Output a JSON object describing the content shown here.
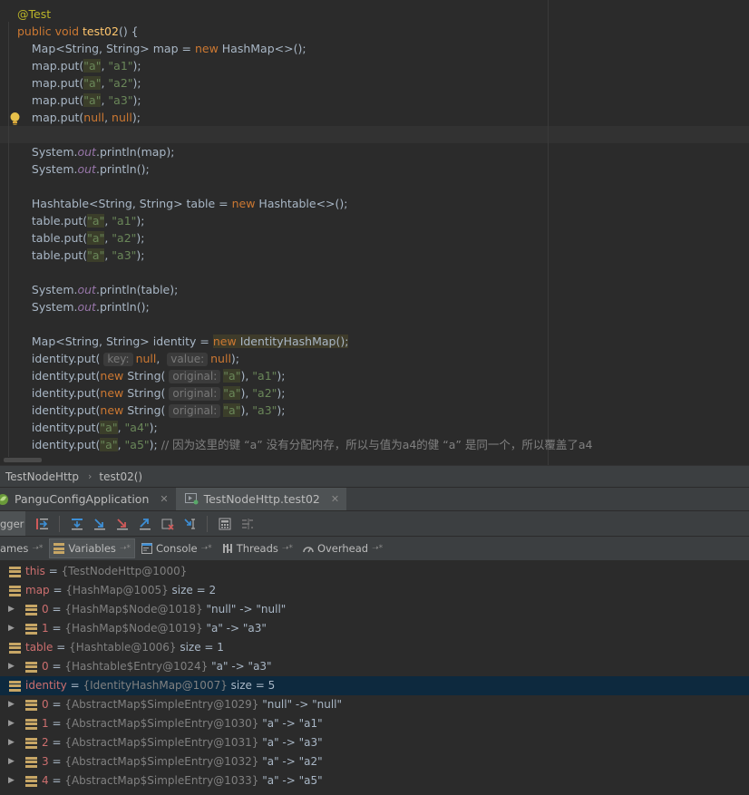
{
  "editor": {
    "lines": [
      {
        "segs": [
          {
            "t": "@Test",
            "c": "ann"
          }
        ]
      },
      {
        "segs": [
          {
            "t": "public ",
            "c": "kw"
          },
          {
            "t": "void ",
            "c": "kw"
          },
          {
            "t": "test02",
            "c": "fn"
          },
          {
            "t": "() {"
          }
        ]
      },
      {
        "segs": [
          {
            "t": "    Map<String, String> map = "
          },
          {
            "t": "new ",
            "c": "kw"
          },
          {
            "t": "HashMap<>();"
          }
        ]
      },
      {
        "segs": [
          {
            "t": "    map.put("
          },
          {
            "t": "\"a\"",
            "c": "str hl-str"
          },
          {
            "t": ", "
          },
          {
            "t": "\"a1\"",
            "c": "str"
          },
          {
            "t": ");"
          }
        ]
      },
      {
        "segs": [
          {
            "t": "    map.put("
          },
          {
            "t": "\"a\"",
            "c": "str hl-str"
          },
          {
            "t": ", "
          },
          {
            "t": "\"a2\"",
            "c": "str"
          },
          {
            "t": ");"
          }
        ]
      },
      {
        "segs": [
          {
            "t": "    map.put("
          },
          {
            "t": "\"a\"",
            "c": "str hl-str"
          },
          {
            "t": ", "
          },
          {
            "t": "\"a3\"",
            "c": "str"
          },
          {
            "t": ");"
          }
        ]
      },
      {
        "segs": [
          {
            "t": "    map.put("
          },
          {
            "t": "null",
            "c": "kw"
          },
          {
            "t": ", "
          },
          {
            "t": "null",
            "c": "kw"
          },
          {
            "t": ");"
          }
        ]
      },
      {
        "segs": []
      },
      {
        "segs": [
          {
            "t": "    System."
          },
          {
            "t": "out",
            "c": "fld"
          },
          {
            "t": ".println(map);"
          }
        ]
      },
      {
        "segs": [
          {
            "t": "    System."
          },
          {
            "t": "out",
            "c": "fld"
          },
          {
            "t": ".println();"
          }
        ]
      },
      {
        "segs": []
      },
      {
        "segs": [
          {
            "t": "    Hashtable<String, String> table = "
          },
          {
            "t": "new ",
            "c": "kw"
          },
          {
            "t": "Hashtable<>();"
          }
        ]
      },
      {
        "segs": [
          {
            "t": "    table.put("
          },
          {
            "t": "\"a\"",
            "c": "str hl-str"
          },
          {
            "t": ", "
          },
          {
            "t": "\"a1\"",
            "c": "str"
          },
          {
            "t": ");"
          }
        ]
      },
      {
        "segs": [
          {
            "t": "    table.put("
          },
          {
            "t": "\"a\"",
            "c": "str hl-str"
          },
          {
            "t": ", "
          },
          {
            "t": "\"a2\"",
            "c": "str"
          },
          {
            "t": ");"
          }
        ]
      },
      {
        "segs": [
          {
            "t": "    table.put("
          },
          {
            "t": "\"a\"",
            "c": "str hl-str"
          },
          {
            "t": ", "
          },
          {
            "t": "\"a3\"",
            "c": "str"
          },
          {
            "t": ");"
          }
        ]
      },
      {
        "segs": []
      },
      {
        "segs": [
          {
            "t": "    System."
          },
          {
            "t": "out",
            "c": "fld"
          },
          {
            "t": ".println(table);"
          }
        ]
      },
      {
        "segs": [
          {
            "t": "    System."
          },
          {
            "t": "out",
            "c": "fld"
          },
          {
            "t": ".println();"
          }
        ]
      },
      {
        "segs": []
      },
      {
        "segs": [
          {
            "t": "    Map<String, String> identity = "
          },
          {
            "t": "new ",
            "c": "kw hl-expr"
          },
          {
            "t": "IdentityHashMap();",
            "c": "hl-expr"
          }
        ]
      },
      {
        "segs": [
          {
            "t": "    identity.put( "
          },
          {
            "t": "key:",
            "c": "hint"
          },
          {
            "t": "null",
            "c": "kw"
          },
          {
            "t": ",  "
          },
          {
            "t": "value:",
            "c": "hint"
          },
          {
            "t": "null",
            "c": "kw"
          },
          {
            "t": ");"
          }
        ]
      },
      {
        "segs": [
          {
            "t": "    identity.put("
          },
          {
            "t": "new ",
            "c": "kw"
          },
          {
            "t": "String( "
          },
          {
            "t": "original:",
            "c": "hint"
          },
          {
            "t": "\"a\"",
            "c": "str hl-str"
          },
          {
            "t": "), "
          },
          {
            "t": "\"a1\"",
            "c": "str"
          },
          {
            "t": ");"
          }
        ]
      },
      {
        "segs": [
          {
            "t": "    identity.put("
          },
          {
            "t": "new ",
            "c": "kw"
          },
          {
            "t": "String( "
          },
          {
            "t": "original:",
            "c": "hint"
          },
          {
            "t": "\"a\"",
            "c": "str hl-str"
          },
          {
            "t": "), "
          },
          {
            "t": "\"a2\"",
            "c": "str"
          },
          {
            "t": ");"
          }
        ]
      },
      {
        "segs": [
          {
            "t": "    identity.put("
          },
          {
            "t": "new ",
            "c": "kw"
          },
          {
            "t": "String( "
          },
          {
            "t": "original:",
            "c": "hint"
          },
          {
            "t": "\"a\"",
            "c": "str hl-str"
          },
          {
            "t": "), "
          },
          {
            "t": "\"a3\"",
            "c": "str"
          },
          {
            "t": ");"
          }
        ]
      },
      {
        "segs": [
          {
            "t": "    identity.put("
          },
          {
            "t": "\"a\"",
            "c": "str hl-str"
          },
          {
            "t": ", "
          },
          {
            "t": "\"a4\"",
            "c": "str"
          },
          {
            "t": ");"
          }
        ]
      },
      {
        "segs": [
          {
            "t": "    identity.put("
          },
          {
            "t": "\"a\"",
            "c": "str hl-str"
          },
          {
            "t": ", "
          },
          {
            "t": "\"a5\"",
            "c": "str"
          },
          {
            "t": "); "
          },
          {
            "t": "// 因为这里的键 “a” 没有分配内存，所以与值为a4的健 “a” 是同一个，所以覆盖了a4",
            "c": "cmt"
          }
        ]
      }
    ]
  },
  "breadcrumb": {
    "items": [
      "TestNodeHttp",
      "test02()"
    ]
  },
  "run_tabs": [
    {
      "label": "PanguConfigApplication",
      "icon": "spring-boot-icon"
    },
    {
      "label": "TestNodeHttp.test02",
      "icon": "junit-run-icon"
    }
  ],
  "debugger": {
    "label": "gger"
  },
  "debug_tabs": [
    {
      "label": "ames",
      "icon": "frames-icon"
    },
    {
      "label": "Variables",
      "icon": "variables-icon"
    },
    {
      "label": "Console",
      "icon": "console-icon"
    },
    {
      "label": "Threads",
      "icon": "threads-icon"
    },
    {
      "label": "Overhead",
      "icon": "overhead-icon"
    }
  ],
  "variables": [
    {
      "level": 0,
      "expand": false,
      "name": "this",
      "type": "{TestNodeHttp@1000}",
      "value": ""
    },
    {
      "level": 0,
      "expand": false,
      "name": "map",
      "type": "{HashMap@1005}",
      "value": " size = 2"
    },
    {
      "level": 1,
      "expand": true,
      "name": "0",
      "type": "{HashMap$Node@1018}",
      "value": " \"null\" -> \"null\""
    },
    {
      "level": 1,
      "expand": true,
      "name": "1",
      "type": "{HashMap$Node@1019}",
      "value": " \"a\" -> \"a3\""
    },
    {
      "level": 0,
      "expand": false,
      "name": "table",
      "type": "{Hashtable@1006}",
      "value": " size = 1"
    },
    {
      "level": 1,
      "expand": true,
      "name": "0",
      "type": "{Hashtable$Entry@1024}",
      "value": " \"a\" -> \"a3\""
    },
    {
      "level": 0,
      "expand": false,
      "name": "identity",
      "type": "{IdentityHashMap@1007}",
      "value": " size = 5",
      "selected": true
    },
    {
      "level": 1,
      "expand": true,
      "name": "0",
      "type": "{AbstractMap$SimpleEntry@1029}",
      "value": " \"null\" -> \"null\""
    },
    {
      "level": 1,
      "expand": true,
      "name": "1",
      "type": "{AbstractMap$SimpleEntry@1030}",
      "value": " \"a\" -> \"a1\""
    },
    {
      "level": 1,
      "expand": true,
      "name": "2",
      "type": "{AbstractMap$SimpleEntry@1031}",
      "value": " \"a\" -> \"a3\""
    },
    {
      "level": 1,
      "expand": true,
      "name": "3",
      "type": "{AbstractMap$SimpleEntry@1032}",
      "value": " \"a\" -> \"a2\""
    },
    {
      "level": 1,
      "expand": true,
      "name": "4",
      "type": "{AbstractMap$SimpleEntry@1033}",
      "value": " \"a\" -> \"a5\""
    }
  ],
  "colors": {
    "editor_bg": "#2b2b2b",
    "panel_bg": "#3c3f41",
    "selection": "#0d293e",
    "keyword": "#cc7832",
    "string": "#6a8759",
    "field_icon": "#c7a665",
    "var_name": "#cd6f6f"
  }
}
